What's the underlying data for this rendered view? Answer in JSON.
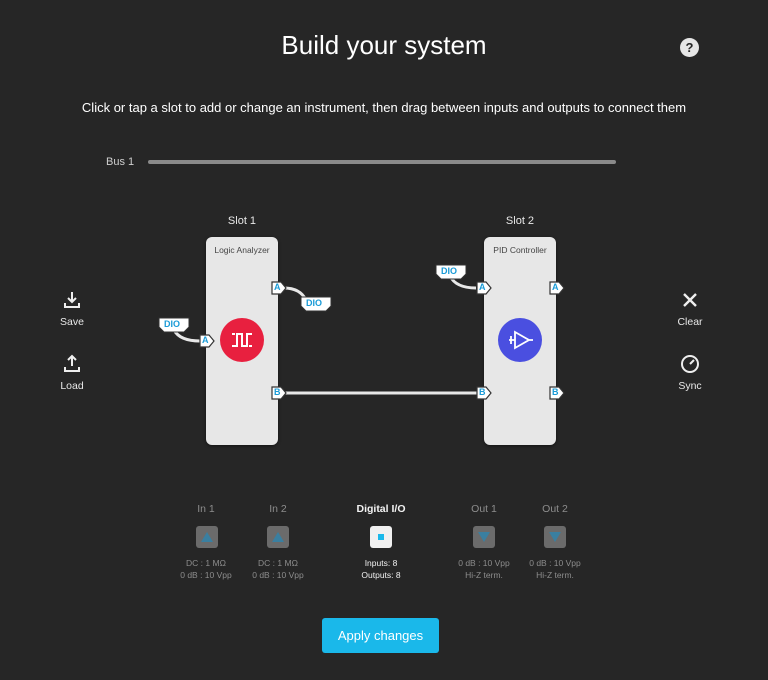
{
  "header": {
    "title": "Build your system",
    "help_label": "?",
    "subtitle": "Click or tap a slot to add or change an instrument, then drag between inputs and outputs to connect them"
  },
  "bus": {
    "label": "Bus 1"
  },
  "left_actions": {
    "save": "Save",
    "load": "Load"
  },
  "right_actions": {
    "clear": "Clear",
    "sync": "Sync"
  },
  "slots": [
    {
      "label": "Slot 1",
      "instrument": "Logic Analyzer",
      "icon": "logic-analyzer-icon",
      "color": "#e8203f"
    },
    {
      "label": "Slot 2",
      "instrument": "PID Controller",
      "icon": "pid-controller-icon",
      "color": "#4a4fe0"
    }
  ],
  "ports": {
    "a": "A",
    "b": "B",
    "dio": "DIO"
  },
  "io": {
    "in1": {
      "label": "In 1",
      "line1": "DC : 1 MΩ",
      "line2": "0 dB : 10 Vpp"
    },
    "in2": {
      "label": "In 2",
      "line1": "DC : 1 MΩ",
      "line2": "0 dB : 10 Vpp"
    },
    "dio": {
      "label": "Digital I/O",
      "line1": "Inputs: 8",
      "line2": "Outputs: 8"
    },
    "out1": {
      "label": "Out 1",
      "line1": "0 dB : 10 Vpp",
      "line2": "Hi-Z term."
    },
    "out2": {
      "label": "Out 2",
      "line1": "0 dB : 10 Vpp",
      "line2": "Hi-Z term."
    }
  },
  "apply_label": "Apply changes",
  "colors": {
    "accent": "#1ab8ea",
    "background": "#262626",
    "card": "#e7e7e7"
  }
}
